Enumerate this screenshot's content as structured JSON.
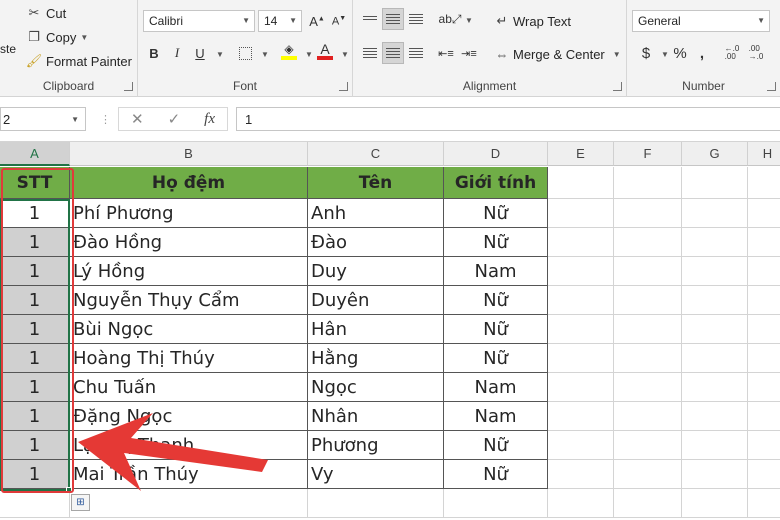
{
  "clipboard": {
    "paste_label": "ste",
    "cut_label": "Cut",
    "copy_label": "Copy",
    "format_painter_label": "Format Painter",
    "group_label": "Clipboard"
  },
  "font": {
    "font_name": "Calibri",
    "font_size": "14",
    "bold_label": "B",
    "italic_label": "I",
    "underline_label": "U",
    "group_label": "Font"
  },
  "alignment": {
    "wrap_text_label": "Wrap Text",
    "merge_center_label": "Merge & Center",
    "group_label": "Alignment"
  },
  "number": {
    "format_value": "General",
    "currency_label": "$",
    "percent_label": "%",
    "comma_label": ",",
    "group_label": "Number"
  },
  "formula_bar": {
    "name_box": "2",
    "fx_label": "fx",
    "value": "1"
  },
  "columns": [
    "A",
    "B",
    "C",
    "D",
    "E",
    "F",
    "G",
    "H"
  ],
  "table": {
    "headers": [
      "STT",
      "Họ đệm",
      "Tên",
      "Giới tính"
    ],
    "rows": [
      {
        "stt": "1",
        "ho_dem": "Phí Phương",
        "ten": "Anh",
        "gioi_tinh": "Nữ"
      },
      {
        "stt": "1",
        "ho_dem": "Đào Hồng",
        "ten": "Đào",
        "gioi_tinh": "Nữ"
      },
      {
        "stt": "1",
        "ho_dem": "Lý Hồng",
        "ten": "Duy",
        "gioi_tinh": "Nam"
      },
      {
        "stt": "1",
        "ho_dem": "Nguyễn Thụy Cẩm",
        "ten": "Duyên",
        "gioi_tinh": "Nữ"
      },
      {
        "stt": "1",
        "ho_dem": "Bùi Ngọc",
        "ten": "Hân",
        "gioi_tinh": "Nữ"
      },
      {
        "stt": "1",
        "ho_dem": "Hoàng Thị Thúy",
        "ten": "Hằng",
        "gioi_tinh": "Nữ"
      },
      {
        "stt": "1",
        "ho_dem": "Chu Tuấn",
        "ten": "Ngọc",
        "gioi_tinh": "Nam"
      },
      {
        "stt": "1",
        "ho_dem": "Đặng Ngọc",
        "ten": "Nhân",
        "gioi_tinh": "Nam"
      },
      {
        "stt": "1",
        "ho_dem": "Lại Thị Thanh",
        "ten": "Phương",
        "gioi_tinh": "Nữ"
      },
      {
        "stt": "1",
        "ho_dem": "Mai Trần Thúy",
        "ten": "Vy",
        "gioi_tinh": "Nữ"
      }
    ]
  },
  "colors": {
    "header_fill": "#70ad47",
    "selection": "#217346",
    "annotation": "#e03a3a"
  }
}
